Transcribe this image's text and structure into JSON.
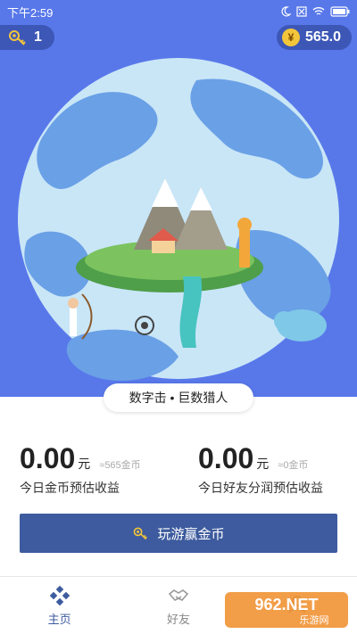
{
  "status_bar": {
    "time": "下午2:59",
    "battery_icon": "battery-icon",
    "wifi_icon": "wifi-icon"
  },
  "header": {
    "keys_count": "1",
    "coins": "565.0",
    "coin_symbol": "¥"
  },
  "banner": {
    "text": "数字击 • 巨数猎人"
  },
  "earnings": {
    "today": {
      "amount": "0.00",
      "unit": "元",
      "approx": "≈565金币",
      "label": "今日金币预估收益"
    },
    "friends": {
      "amount": "0.00",
      "unit": "元",
      "approx": "≈0金币",
      "label": "今日好友分润预估收益"
    }
  },
  "play_button": {
    "label": "玩游赢金币"
  },
  "tabs": [
    {
      "label": "主页",
      "icon": "home-icon",
      "active": true
    },
    {
      "label": "好友",
      "icon": "handshake-icon",
      "active": false
    },
    {
      "label": "",
      "icon": "profile-icon",
      "active": false
    }
  ],
  "watermark": {
    "text": "962.NET",
    "sub": "乐游网"
  },
  "colors": {
    "hero_bg": "#5878ea",
    "button": "#3d5b9e",
    "coin": "#f3c53a"
  }
}
